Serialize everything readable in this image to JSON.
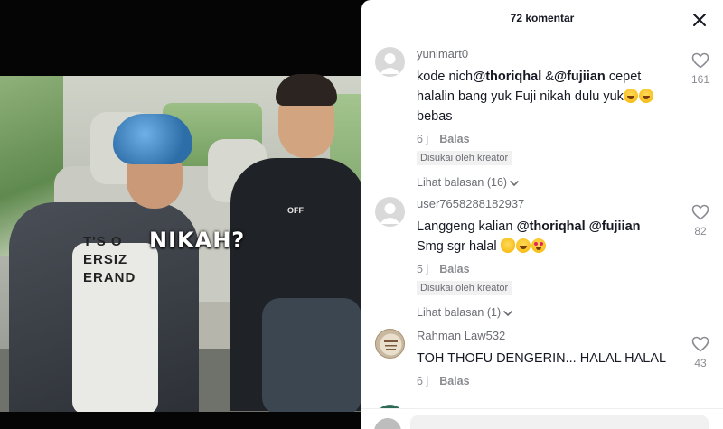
{
  "video": {
    "caption": "NIKAH?",
    "shirt_print": "T'S O\nERSIZ\nERAND",
    "hoodie_print": "OFF"
  },
  "panel": {
    "title": "72 komentar"
  },
  "comments": [
    {
      "username": "yunimart0",
      "text_parts": [
        "kode nich",
        "@thoriqhal",
        " &",
        "@fujiian",
        " cepet halalin bang yuk Fuji nikah dulu yuk",
        " bebas"
      ],
      "emojis": [
        "laugh",
        "laugh"
      ],
      "time": "6 j",
      "reply_label": "Balas",
      "liked_by_creator": "Disukai oleh kreator",
      "view_replies": "Lihat balasan (16)",
      "likes": "161"
    },
    {
      "username": "user7658288182937",
      "text_parts": [
        "Langgeng kalian ",
        "@thoriqhal",
        " ",
        "@fujiian",
        " Smg sgr halal "
      ],
      "emojis": [
        "hands",
        "laugh",
        "heart-eyes"
      ],
      "time": "5 j",
      "reply_label": "Balas",
      "liked_by_creator": "Disukai oleh kreator",
      "view_replies": "Lihat balasan (1)",
      "likes": "82"
    },
    {
      "username": "Rahman Law532",
      "text": "TOH THOFU DENGERIN... HALAL HALAL",
      "time": "6 j",
      "reply_label": "Balas",
      "likes": "43"
    }
  ],
  "icons": {
    "close": "close-icon",
    "heart": "heart-icon",
    "chevron": "chevron-down-icon",
    "mention": "at-icon",
    "gift": "gift-icon",
    "emoji": "emoji-icon"
  }
}
